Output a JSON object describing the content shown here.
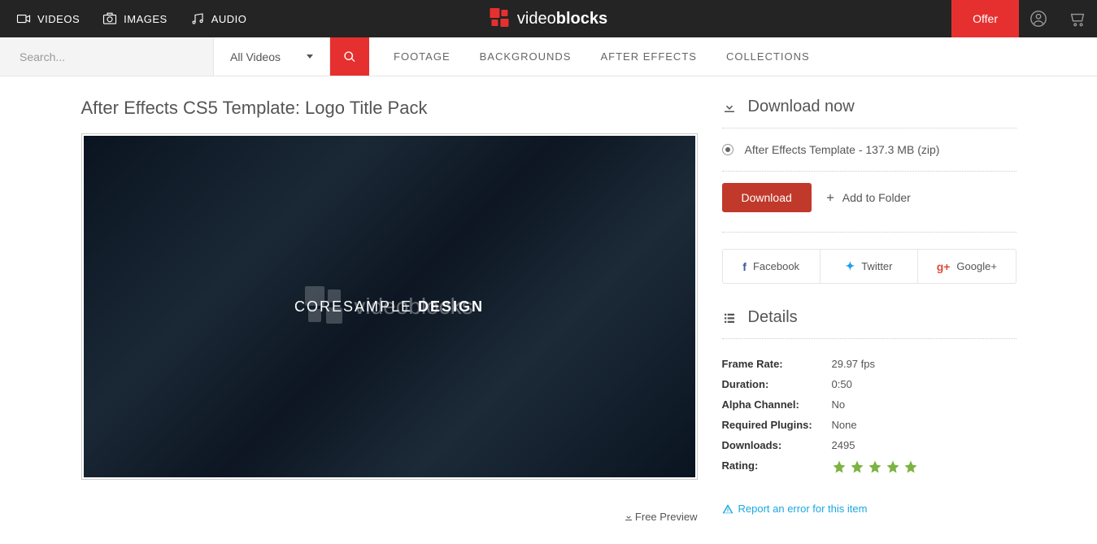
{
  "topnav": {
    "videos": "VIDEOS",
    "images": "IMAGES",
    "audio": "AUDIO"
  },
  "brand": {
    "prefix": "video",
    "bold": "blocks"
  },
  "offer": "Offer",
  "search": {
    "placeholder": "Search...",
    "dropdown": "All Videos"
  },
  "subnav": {
    "footage": "FOOTAGE",
    "backgrounds": "BACKGROUNDS",
    "aftereffects": "AFTER EFFECTS",
    "collections": "COLLECTIONS"
  },
  "page": {
    "title": "After Effects CS5 Template: Logo Title Pack",
    "center_prefix": "CORESAMPLE ",
    "center_bold": "DESIGN",
    "free_preview": "Free Preview"
  },
  "download": {
    "heading": "Download now",
    "option": "After Effects Template - 137.3 MB (zip)",
    "button": "Download",
    "add_folder": "Add to Folder"
  },
  "share": {
    "facebook": "Facebook",
    "twitter": "Twitter",
    "google": "Google+"
  },
  "details": {
    "heading": "Details",
    "rows": {
      "frame_rate": {
        "label": "Frame Rate:",
        "value": "29.97 fps"
      },
      "duration": {
        "label": "Duration:",
        "value": "0:50"
      },
      "alpha": {
        "label": "Alpha Channel:",
        "value": "No"
      },
      "plugins": {
        "label": "Required Plugins:",
        "value": "None"
      },
      "downloads": {
        "label": "Downloads:",
        "value": "2495"
      },
      "rating": {
        "label": "Rating:"
      }
    }
  },
  "report": "Report an error for this item"
}
